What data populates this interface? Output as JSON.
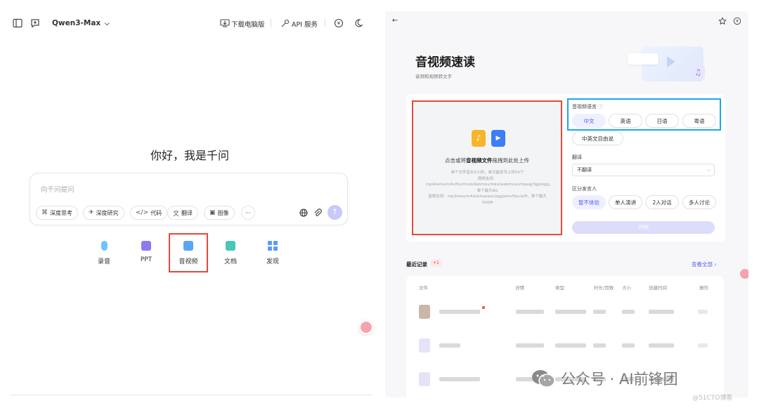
{
  "left": {
    "model_name": "Qwen3-Max",
    "download_label": "下载电脑版",
    "api_label": "API 服务",
    "greeting": "你好，我是千问",
    "input_placeholder": "向千问提问",
    "chips": [
      "深度思考",
      "深度研究",
      "代码",
      "翻译",
      "图像"
    ],
    "more_label": "···",
    "quick_items": [
      {
        "label": "录音",
        "color": "#6fc3ff"
      },
      {
        "label": "PPT",
        "color": "#8a7cf0"
      },
      {
        "label": "音视频",
        "color": "#5aa6f5"
      },
      {
        "label": "文档",
        "color": "#47c7b8"
      },
      {
        "label": "发现",
        "color": "#5a9cf5"
      }
    ]
  },
  "right": {
    "title": "音视频速读",
    "subtitle": "音频和视频转文字",
    "upload_main_prefix": "点击或将",
    "upload_main_bold": "音视频文件",
    "upload_main_suffix": "拖拽到此处上传",
    "upload_hint_1": "单个文件音长5小时，单次最多可上传50个",
    "upload_hint_2": "视频支持：mp4/wmv/m4v/flv/rmvb/dat/mov/mkv/webm/avi/mpeg/3gp/ogg，单个最大6G",
    "upload_hint_3": "音频支持：mp3/wav/m4a/wma/aac/ogg/amr/flac/aiff，单个最大500M",
    "lang_label": "音视频语言",
    "languages": [
      "中文",
      "英语",
      "日语",
      "粤语"
    ],
    "mixed_lang": "中英文自由说",
    "translate_label": "翻译",
    "translate_value": "不翻译",
    "speaker_label": "区分发言人",
    "speaker_options": [
      "暂不体验",
      "单人演讲",
      "2人对话",
      "多人讨论"
    ],
    "start_label": "开始",
    "recent_label": "最近记录",
    "recent_badge": "+1",
    "view_all": "查看全部",
    "table_headers": [
      "文件",
      "详情",
      "类型",
      "时长/页数",
      "大小",
      "创建时间",
      "操作"
    ]
  },
  "watermark": {
    "text": "公众号 · AI前锋团",
    "credit": "@51CTO博客"
  },
  "colors": {
    "red_highlight": "#e8473a",
    "blue_highlight": "#1aa7ee",
    "accent": "#6b6ff2"
  }
}
